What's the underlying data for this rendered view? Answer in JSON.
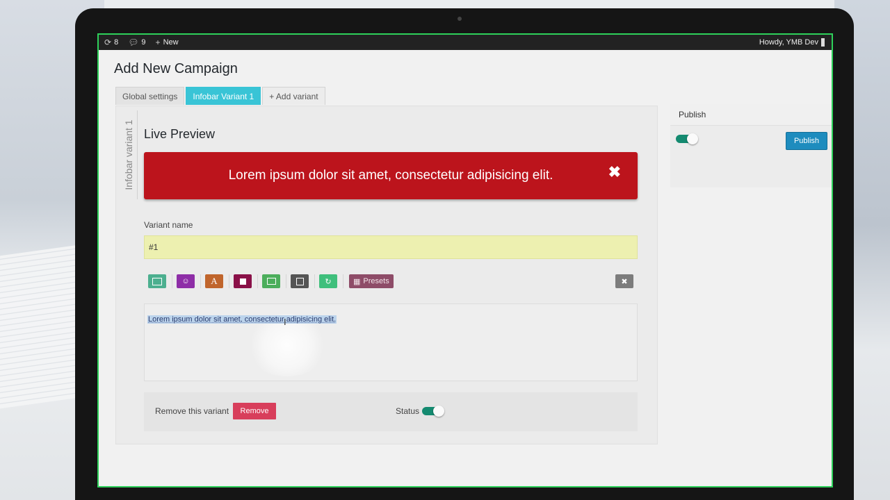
{
  "admin_bar": {
    "updates_count": "8",
    "comments_count": "9",
    "new_label": "New",
    "howdy": "Howdy, YMB Dev"
  },
  "page": {
    "title": "Add New Campaign"
  },
  "tabs": [
    {
      "label": "Global settings",
      "active": false
    },
    {
      "label": "Infobar Variant 1",
      "active": true
    },
    {
      "label": "+ Add variant",
      "active": false
    }
  ],
  "variant_panel": {
    "side_label": "Infobar variant 1",
    "live_preview_title": "Live Preview",
    "infobar": {
      "text": "Lorem ipsum dolor sit amet, consectetur adipisicing elit.",
      "close_symbol": "✖",
      "color": "#bc141c"
    },
    "variant_name": {
      "label": "Variant name",
      "value": "#1"
    },
    "toolbar": {
      "buttons": [
        {
          "icon": "text-block-icon",
          "color": "#4caf8f"
        },
        {
          "icon": "emoji-icon",
          "color": "#8e2ea7"
        },
        {
          "icon": "font-color-icon",
          "color": "#c0652c",
          "glyph": "A"
        },
        {
          "icon": "background-color-icon",
          "color": "#8a1148"
        },
        {
          "icon": "image-icon",
          "color": "#4cae5c"
        },
        {
          "icon": "edit-image-icon",
          "color": "#555555"
        },
        {
          "icon": "refresh-icon",
          "color": "#3fbf7c"
        }
      ],
      "presets_label": "Presets",
      "close_symbol": "✖"
    },
    "editor_text": "Lorem ipsum dolor sit amet, consectetur adipisicing elit.",
    "remove_label": "Remove this variant",
    "remove_button": "Remove",
    "status_label": "Status",
    "status_on": true
  },
  "publish_box": {
    "title": "Publish",
    "toggle_on": true,
    "button": "Publish"
  }
}
